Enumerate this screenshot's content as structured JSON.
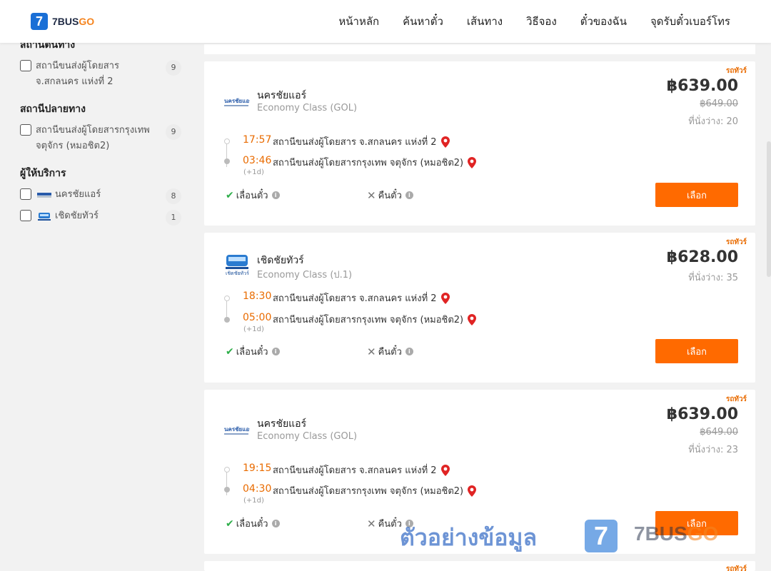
{
  "header": {
    "logo_number": "7",
    "logo_text_a": "7BUS",
    "logo_text_b": "GO",
    "nav": [
      "หน้าหลัก",
      "ค้นหาตั๋ว",
      "เส้นทาง",
      "วิธีจอง",
      "ตั๋วของฉัน",
      "จุดรับตั๋วเบอร์โทร"
    ]
  },
  "sidebar": {
    "origin_heading": "สถานีต้นทาง",
    "origin_items": [
      {
        "label": "สถานีขนส่งผู้โดยสาร จ.สกลนคร แห่งที่ 2",
        "count": "9"
      }
    ],
    "dest_heading": "สถานีปลายทาง",
    "dest_items": [
      {
        "label": "สถานีขนส่งผู้โดยสารกรุงเทพ จตุจักร (หมอชิต2)",
        "count": "9"
      }
    ],
    "provider_heading": "ผู้ให้บริการ",
    "provider_items": [
      {
        "label": "นครชัยแอร์",
        "count": "8"
      },
      {
        "label": "เชิดชัยทัวร์",
        "count": "1"
      }
    ]
  },
  "cards": [
    {
      "ribbon": "รถทัวร์",
      "operator": "นครชัยแอร์",
      "class": "Economy Class (GOL)",
      "price": "฿639.00",
      "old_price": "฿649.00",
      "seats": "ที่นั่งว่าง: 20",
      "dep_time": "17:57",
      "dep_station": "สถานีขนส่งผู้โดยสาร จ.สกลนคร แห่งที่ 2",
      "arr_time": "03:46",
      "arr_station": "สถานีขนส่งผู้โดยสารกรุงเทพ จตุจักร (หมอชิต2)",
      "plus_day": "(+1d)",
      "reschedule": "เลื่อนตั๋ว",
      "refund": "คืนตั๋ว",
      "select": "เลือก"
    },
    {
      "ribbon": "รถทัวร์",
      "operator": "เชิดชัยทัวร์",
      "class": "Economy Class (ป.1)",
      "price": "฿628.00",
      "old_price": "",
      "seats": "ที่นั่งว่าง: 35",
      "dep_time": "18:30",
      "dep_station": "สถานีขนส่งผู้โดยสาร จ.สกลนคร แห่งที่ 2",
      "arr_time": "05:00",
      "arr_station": "สถานีขนส่งผู้โดยสารกรุงเทพ จตุจักร (หมอชิต2)",
      "plus_day": "(+1d)",
      "reschedule": "เลื่อนตั๋ว",
      "refund": "คืนตั๋ว",
      "select": "เลือก"
    },
    {
      "ribbon": "รถทัวร์",
      "operator": "นครชัยแอร์",
      "class": "Economy Class (GOL)",
      "price": "฿639.00",
      "old_price": "฿649.00",
      "seats": "ที่นั่งว่าง: 23",
      "dep_time": "19:15",
      "dep_station": "สถานีขนส่งผู้โดยสาร จ.สกลนคร แห่งที่ 2",
      "arr_time": "04:30",
      "arr_station": "สถานีขนส่งผู้โดยสารกรุงเทพ จตุจักร (หมอชิต2)",
      "plus_day": "(+1d)",
      "reschedule": "เลื่อนตั๋ว",
      "refund": "คืนตั๋ว",
      "select": "เลือก"
    }
  ],
  "partial_card_ribbon": "รถทัวร์",
  "watermark": {
    "text": "ตัวอย่างข้อมูล",
    "logo_number": "7",
    "brand_a": "7BUS",
    "brand_b": "GO"
  }
}
